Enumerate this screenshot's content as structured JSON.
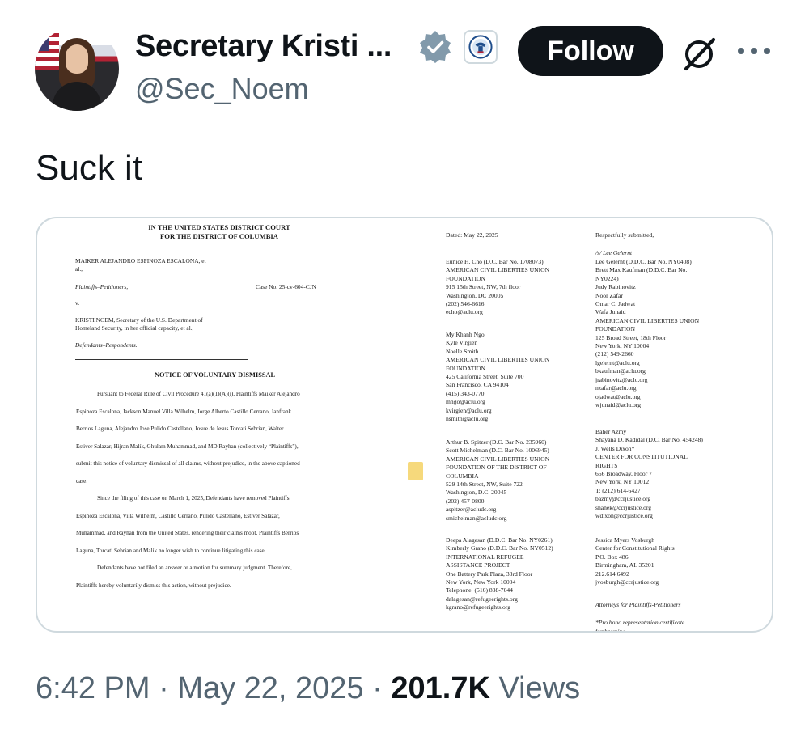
{
  "author": {
    "display_name": "Secretary Kristi ...",
    "handle": "@Sec_Noem",
    "follow_label": "Follow"
  },
  "icons": {
    "avatar": "profile-photo",
    "verified": "verified-badge-icon",
    "affiliation": "dhs-seal-icon",
    "grok": "grok-icon",
    "more": "more-icon"
  },
  "colors": {
    "verified_badge": "#829aab",
    "follow_bg": "#0f1419",
    "muted_text": "#536471"
  },
  "tweet": {
    "text": "Suck it",
    "time": "6:42 PM",
    "separator": "·",
    "date": "May 22, 2025",
    "views_count": "201.7K",
    "views_label": "Views"
  },
  "document": {
    "court_line1": "IN THE UNITED STATES DISTRICT COURT",
    "court_line2": "FOR THE DISTRICT OF COLUMBIA",
    "plaintiff_line1": "MAIKER ALEJANDRO ESPINOZA ESCALONA, et",
    "plaintiff_line2": "al.,",
    "plaintiff_role": "Plaintiffs–Petitioners,",
    "versus": "v.",
    "defendant_line1": "KRISTI NOEM, Secretary of the U.S. Department of",
    "defendant_line2": "Homeland Security, in her official capacity, et al.,",
    "defendant_role": "Defendants–Respondents.",
    "case_no": "Case No. 25-cv-604-CJN",
    "title": "NOTICE OF VOLUNTARY DISMISSAL",
    "body_lines": [
      "Pursuant to Federal Rule of Civil Procedure 41(a)(1)(A)(i), Plaintiffs Maiker Alejandro",
      "Espinoza Escalona, Jackson Manuel Villa Wilhelm, Jorge Alberto Castillo Cerrano, Janfrank",
      "Berrios Laguna, Alejandro Jose Pulido Castellano, Josue de Jesus Torcati Sebrian, Walter",
      "Estiver Salazar, Hijran Malik, Ghulam Muhammad, and MD Rayhan (collectively “Plaintiffs”),",
      "submit this notice of voluntary dismissal of all claims, without prejudice, in the above captioned",
      "case.",
      "Since the filing of this case on March 1, 2025, Defendants have removed Plaintiffs",
      "Espinoza Escalona, Villa Wilhelm, Castillo Cerrano, Pulido Castellano, Estiver Salazar,",
      "Muhammad, and Rayhan from the United States, rendering their claims moot. Plaintiffs Berrios",
      "Laguna, Torcati Sebrian and Malik no longer wish to continue litigating this case.",
      "Defendants have not filed an answer or a motion for summary judgment. Therefore,",
      "Plaintiffs hereby voluntarily dismiss this action, without prejudice."
    ],
    "dated": "Dated: May 22, 2025",
    "respectfully": "Respectfully submitted,",
    "left_blocks": [
      [
        "Eunice H. Cho (D.C. Bar No. 1708073)",
        "AMERICAN CIVIL LIBERTIES UNION",
        "FOUNDATION",
        "915 15th Street, NW, 7th floor",
        "Washington, DC 20005",
        "(202) 546-6616",
        "echo@aclu.org"
      ],
      [
        "My Khanh Ngo",
        "Kyle Virgien",
        "Noelle Smith",
        "AMERICAN CIVIL LIBERTIES UNION",
        "FOUNDATION",
        "425 California Street, Suite 700",
        "San Francisco, CA 94104",
        "(415) 343-0770",
        "mngo@aclu.org",
        "kvirgien@aclu.org",
        "nsmith@aclu.org"
      ],
      [
        "Arthur B. Spitzer (D.C. Bar No. 235960)",
        "Scott Michelman (D.C. Bar No. 1006945)",
        "AMERICAN CIVIL LIBERTIES UNION",
        "FOUNDATION OF THE DISTRICT OF",
        "COLUMBIA",
        "529 14th Street, NW, Suite 722",
        "Washington, D.C. 20045",
        "(202) 457-0800",
        "aspitzer@acludc.org",
        "smichelman@acludc.org"
      ],
      [
        "Deepa Alagesan (D.D.C. Bar No. NY0261)",
        "Kimberly Grano (D.D.C. Bar No. NY0512)",
        "INTERNATIONAL REFUGEE",
        "ASSISTANCE PROJECT",
        "One Battery Park Plaza, 33rd Floor",
        "New York, New York 10004",
        "Telephone: (516) 838-7044",
        "dalagesan@refugeerights.org",
        "kgrano@refugeerights.org"
      ]
    ],
    "signature": "/s/ Lee Gelernt",
    "right_blocks": [
      [
        "Lee Gelernt (D.D.C. Bar No. NY0408)",
        "Brett Max Kaufman (D.D.C. Bar No.",
        "NY0224)",
        "Judy Rabinovitz",
        "Noor Zafar",
        "Omar C. Jadwat",
        "Wafa Junaid",
        "AMERICAN CIVIL LIBERTIES UNION",
        "FOUNDATION",
        "125 Broad Street, 18th Floor",
        "New York, NY 10004",
        "(212) 549-2660",
        "lgelernt@aclu.org",
        "bkaufman@aclu.org",
        "jrabinovitz@aclu.org",
        "nzafar@aclu.org",
        "ojadwat@aclu.org",
        "wjunaid@aclu.org"
      ],
      [
        "Baher Azmy",
        "Shayana D. Kadidal (D.C. Bar No. 454248)",
        "J. Wells Dixon*",
        "CENTER FOR CONSTITUTIONAL",
        "RIGHTS",
        "666 Broadway, Floor 7",
        "New York, NY 10012",
        "T: (212) 614-6427",
        "bazmy@ccrjustice.org",
        "shanek@ccrjustice.org",
        "wdixon@ccrjustice.org"
      ],
      [
        "Jessica Myers Vosburgh",
        "Center for Constitutional Rights",
        "P.O. Box 486",
        "Birmingham, AL 35201",
        "212.614.6492",
        "jvosburgh@ccrjustice.org"
      ]
    ],
    "attorneys_for": "Attorneys for Plaintiffs-Petitioners",
    "pro_bono": "*Pro bono representation certificate",
    "pro_bono_cut": "forthcoming"
  }
}
